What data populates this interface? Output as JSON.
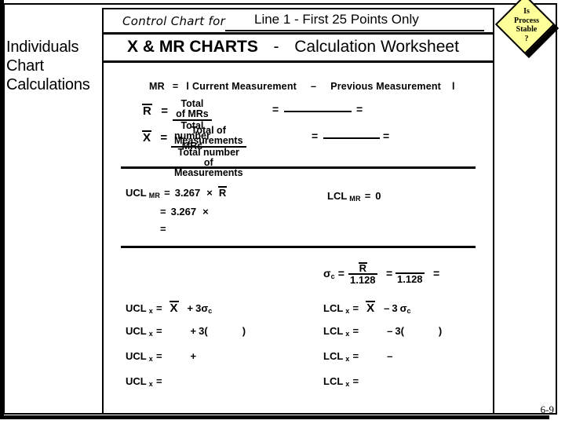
{
  "slide": {
    "side_caption": "Individuals\nChart\nCalculations",
    "page_number": "6-9"
  },
  "badge": {
    "text": "Is\nProcess\nStable\n?",
    "fill_color": "#FFFF99",
    "outline_color": "#000000"
  },
  "worksheet": {
    "control_chart_for_label": "Control Chart for",
    "control_chart_for_value": "Line 1 - First 25 Points Only",
    "main_title_bold": "X & MR CHARTS",
    "main_title_dash": "-",
    "main_title_rest": "Calculation Worksheet",
    "mr_definition": {
      "lead": "MR",
      "equals": "=",
      "bar_open": "l",
      "term1": "Current Measurement",
      "minus": "–",
      "term2": "Previous Measurement",
      "bar_close": "l"
    },
    "rbar_row": {
      "symbol": "R",
      "equals": "=",
      "numerator": "Total of MRs",
      "denominator": "Total number MRs",
      "equals2": "=",
      "equals3": "="
    },
    "xbar_row": {
      "symbol": "X",
      "equals": "=",
      "numerator": "Total of Measurements",
      "denominator": "Total number of Measurements",
      "equals2": "=",
      "equals3": "="
    },
    "ucl_mr": {
      "label": "UCL",
      "sub": "MR",
      "equals": "=",
      "constant": "3.267",
      "times": "×",
      "operand": "R",
      "line2_equals": "=",
      "line2_constant": "3.267",
      "line2_times": "×",
      "line3_equals": "="
    },
    "lcl_mr": {
      "label": "LCL",
      "sub": "MR",
      "equals": "=",
      "value": "0"
    },
    "sigma": {
      "symbol": "σ",
      "sub": "c",
      "equals": "=",
      "numerator": "R",
      "denominator": "1.128",
      "equals2": "=",
      "denominator2": "1.128",
      "equals3": "="
    },
    "ucl_x_rows": [
      {
        "label": "UCL",
        "sub": "x",
        "equals": "=",
        "operand": "X",
        "sign": "+",
        "coef": "3",
        "sigma": "σ",
        "sigma_sub": "c"
      },
      {
        "label": "UCL",
        "sub": "x",
        "equals": "=",
        "operand": "",
        "sign": "+",
        "coef": "3",
        "paren_open": "(",
        "paren_close": ")"
      },
      {
        "label": "UCL",
        "sub": "x",
        "equals": "=",
        "operand": "",
        "sign": "+"
      },
      {
        "label": "UCL",
        "sub": "x",
        "equals": "=",
        "operand": "",
        "sign": ""
      }
    ],
    "lcl_x_rows": [
      {
        "label": "LCL",
        "sub": "x",
        "equals": "=",
        "operand": "X",
        "sign": "–",
        "coef": "3",
        "sigma": "σ",
        "sigma_sub": "c"
      },
      {
        "label": "LCL",
        "sub": "x",
        "equals": "=",
        "operand": "",
        "sign": "–",
        "coef": "3",
        "paren_open": "(",
        "paren_close": ")"
      },
      {
        "label": "LCL",
        "sub": "x",
        "equals": "=",
        "operand": "",
        "sign": "–"
      },
      {
        "label": "LCL",
        "sub": "x",
        "equals": "=",
        "operand": "",
        "sign": ""
      }
    ]
  }
}
